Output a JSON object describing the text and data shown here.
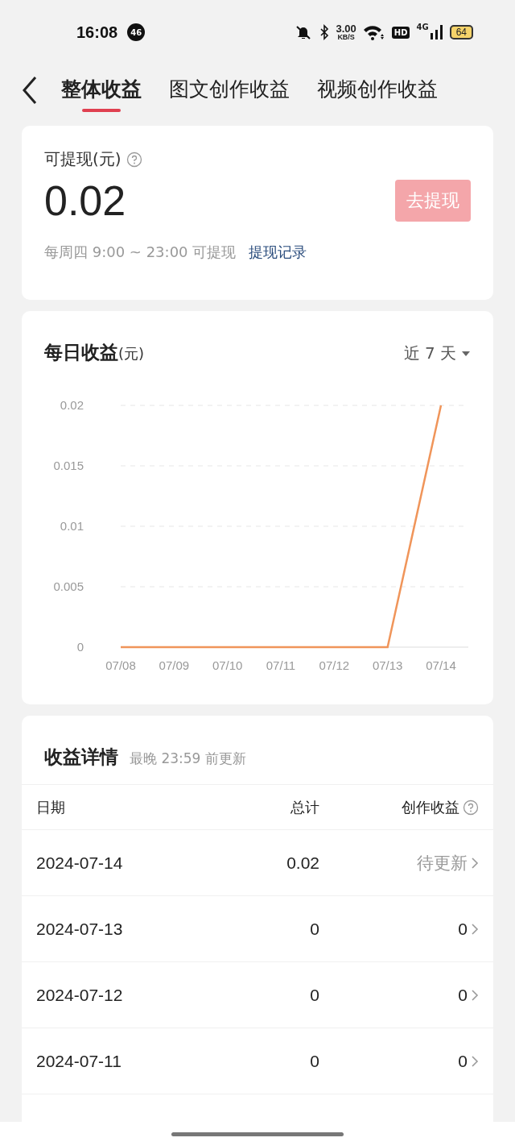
{
  "status_bar": {
    "time": "16:08",
    "notification_count": "46",
    "speed_value": "3.00",
    "speed_unit": "KB/S",
    "hd_label": "HD",
    "network": "4G",
    "battery": "64"
  },
  "tabs": [
    {
      "label": "整体收益",
      "selected": true
    },
    {
      "label": "图文创作收益",
      "selected": false
    },
    {
      "label": "视频创作收益",
      "selected": false
    }
  ],
  "balance_card": {
    "label": "可提现(元)",
    "amount": "0.02",
    "withdraw_button": {
      "label": "去提现",
      "disabled": true
    },
    "schedule": "每周四 9:00 ~ 23:00 可提现",
    "history_link": "提现记录"
  },
  "daily_card": {
    "title": "每日收益",
    "unit": "(元)",
    "range": "近 7 天",
    "chart_data": {
      "type": "line",
      "categories": [
        "07/08",
        "07/09",
        "07/10",
        "07/11",
        "07/12",
        "07/13",
        "07/14"
      ],
      "grid": true,
      "series": [
        {
          "color": "#f0955a",
          "values": [
            0,
            0,
            0,
            0,
            0,
            0,
            0.02
          ]
        }
      ],
      "ylim": [
        0,
        0.02
      ],
      "yticks": [
        0,
        0.005,
        0.01,
        0.015,
        0.02
      ]
    }
  },
  "details": {
    "title": "收益详情",
    "note": "最晚 23:59 前更新",
    "columns": [
      "日期",
      "总计",
      "创作收益"
    ],
    "rows": [
      {
        "date": "2024-07-14",
        "total": "0.02",
        "creation": "待更新",
        "pending": true
      },
      {
        "date": "2024-07-13",
        "total": "0",
        "creation": "0",
        "pending": false
      },
      {
        "date": "2024-07-12",
        "total": "0",
        "creation": "0",
        "pending": false
      },
      {
        "date": "2024-07-11",
        "total": "0",
        "creation": "0",
        "pending": false
      }
    ]
  }
}
